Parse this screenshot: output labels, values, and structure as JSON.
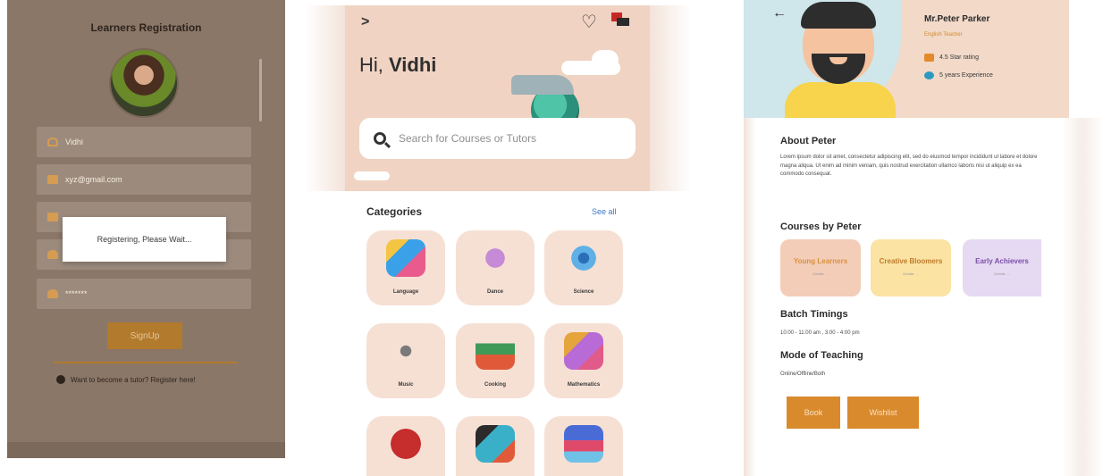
{
  "registration": {
    "title": "Learners Registration",
    "fields": {
      "name_value": "Vidhi",
      "email_value": "xyz@gmail.com",
      "password_value": "*******"
    },
    "dialog_text": "Registering, Please Wait...",
    "signup_label": "SignUp",
    "tutor_prompt": "Want to become a tutor? Register here!",
    "colors": {
      "overlay": "#8a7768",
      "accent": "#b27a2c"
    }
  },
  "home": {
    "greeting_prefix": "Hi, ",
    "user_name": "Vidhi",
    "search_placeholder": "Search for Courses or Tutors",
    "categories_heading": "Categories",
    "see_all_label": "See all",
    "categories": [
      {
        "label": "Language"
      },
      {
        "label": "Dance"
      },
      {
        "label": "Science"
      },
      {
        "label": "Music"
      },
      {
        "label": "Cooking"
      },
      {
        "label": "Mathematics"
      },
      {
        "label": ""
      },
      {
        "label": ""
      },
      {
        "label": ""
      }
    ],
    "icons": {
      "back": "chevron-right-icon",
      "wishlist": "heart-icon",
      "cart": "cart-icon",
      "search": "search-icon"
    },
    "colors": {
      "hero": "#f0d3c2",
      "tile": "#f6e0d4",
      "link": "#3c79c8"
    }
  },
  "tutor": {
    "name": "Mr.Peter Parker",
    "role": "English Teacher",
    "rating_text": "4.5 Star rating",
    "experience_text": "5 years Experience",
    "about_heading": "About Peter",
    "about_text": "Lorem ipsum dolor sit amet, consectetur adipiscing elit, sed do eiusmod tempor incididunt ut labore et dolore magna aliqua. Ut enim ad minim veniam, quis nostrud exercitation ullamco laboris nisi ut aliquip ex ea commodo consequat.",
    "courses_heading": "Courses by Peter",
    "courses": [
      {
        "title": "Young Learners",
        "sub": "Details →"
      },
      {
        "title": "Creative Bloomers",
        "sub": "Details →"
      },
      {
        "title": "Early Achievers",
        "sub": "Details →"
      }
    ],
    "batch_heading": "Batch Timings",
    "batch_text": "10:00 - 11:00 am , 3:00 - 4:00 pm",
    "mode_heading": "Mode of Teaching",
    "mode_text": "Online/Offline/Both",
    "book_label": "Book",
    "wishlist_label": "Wishlist",
    "colors": {
      "header": "#f2d9c8",
      "button": "#d98a2c"
    }
  }
}
